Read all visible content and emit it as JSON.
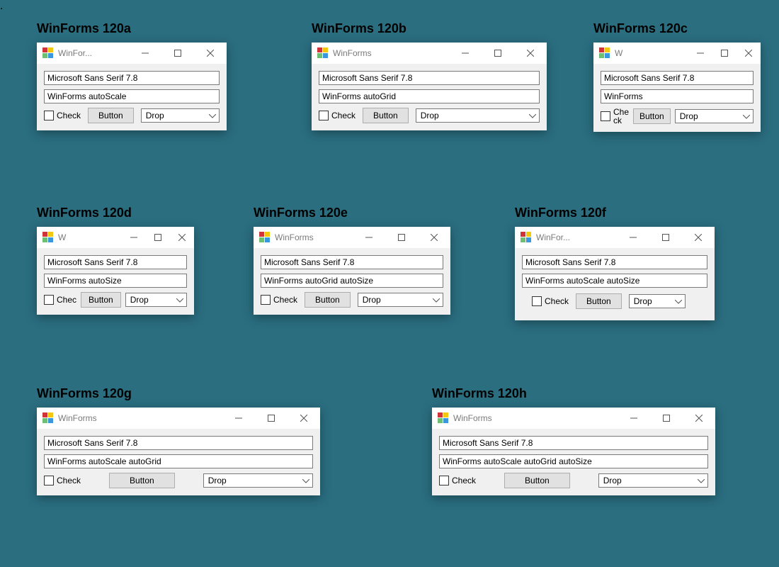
{
  "windows": {
    "a": {
      "heading": "WinForms 120a",
      "title": "WinFor...",
      "text1": "Microsoft Sans Serif 7.8",
      "text2": "WinForms autoScale",
      "check": "Check",
      "button": "Button",
      "drop": "Drop"
    },
    "b": {
      "heading": "WinForms 120b",
      "title": "WinForms",
      "text1": "Microsoft Sans Serif 7.8",
      "text2": "WinForms autoGrid",
      "check": "Check",
      "button": "Button",
      "drop": "Drop"
    },
    "c": {
      "heading": "WinForms 120c",
      "title": "W",
      "text1": "Microsoft Sans Serif 7.8",
      "text2": "WinForms",
      "check": "Check",
      "button": "Button",
      "drop": "Drop"
    },
    "d": {
      "heading": "WinForms 120d",
      "title": "W",
      "text1": "Microsoft Sans Serif 7.8",
      "text2": "WinForms autoSize",
      "check": "Chec",
      "button": "Button",
      "drop": "Drop"
    },
    "e": {
      "heading": "WinForms 120e",
      "title": "WinForms",
      "text1": "Microsoft Sans Serif 7.8",
      "text2": "WinForms autoGrid autoSize",
      "check": "Check",
      "button": "Button",
      "drop": "Drop"
    },
    "f": {
      "heading": "WinForms 120f",
      "title": "WinFor...",
      "text1": "Microsoft Sans Serif 7.8",
      "text2": "WinForms autoScale autoSize",
      "check": "Check",
      "button": "Button",
      "drop": "Drop"
    },
    "g": {
      "heading": "WinForms 120g",
      "title": "WinForms",
      "text1": "Microsoft Sans Serif 7.8",
      "text2": "WinForms autoScale autoGrid",
      "check": "Check",
      "button": "Button",
      "drop": "Drop"
    },
    "h": {
      "heading": "WinForms 120h",
      "title": "WinForms",
      "text1": "Microsoft Sans Serif 7.8",
      "text2": "WinForms autoScale autoGrid autoSize",
      "check": "Check",
      "button": "Button",
      "drop": "Drop"
    }
  }
}
